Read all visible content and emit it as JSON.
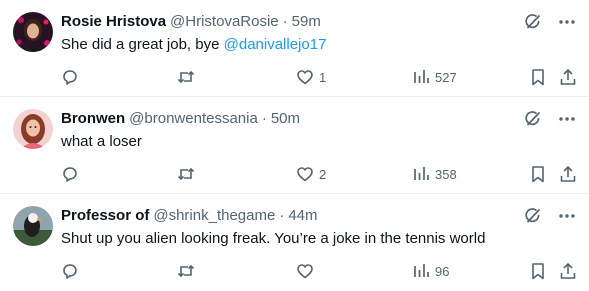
{
  "replies": [
    {
      "display_name": "Rosie Hristova",
      "handle": "@HristovaRosie",
      "separator": "·",
      "time": "59m",
      "text": "She did a great job, bye ",
      "mention": "@danivallejo17",
      "counts": {
        "reply": "",
        "retweet": "",
        "like": "1",
        "views": "527"
      }
    },
    {
      "display_name": "Bronwen",
      "handle": "@bronwentessania",
      "separator": "·",
      "time": "50m",
      "text": "what a loser",
      "mention": "",
      "counts": {
        "reply": "",
        "retweet": "",
        "like": "2",
        "views": "358"
      }
    },
    {
      "display_name": "Professor of",
      "handle": "@shrink_thegame",
      "separator": "·",
      "time": "44m",
      "text": "Shut up you alien looking freak. You’re a joke in the tennis world",
      "mention": "",
      "counts": {
        "reply": "",
        "retweet": "",
        "like": "",
        "views": "96"
      }
    }
  ],
  "icons": {
    "grok": "grok-icon",
    "more": "more-icon",
    "reply": "reply-icon",
    "retweet": "retweet-icon",
    "like": "like-icon",
    "views": "views-icon",
    "bookmark": "bookmark-icon",
    "share": "share-icon"
  },
  "colors": {
    "text_primary": "#0f1419",
    "text_secondary": "#536471",
    "link": "#1d9bf0",
    "divider": "#eff3f4"
  }
}
